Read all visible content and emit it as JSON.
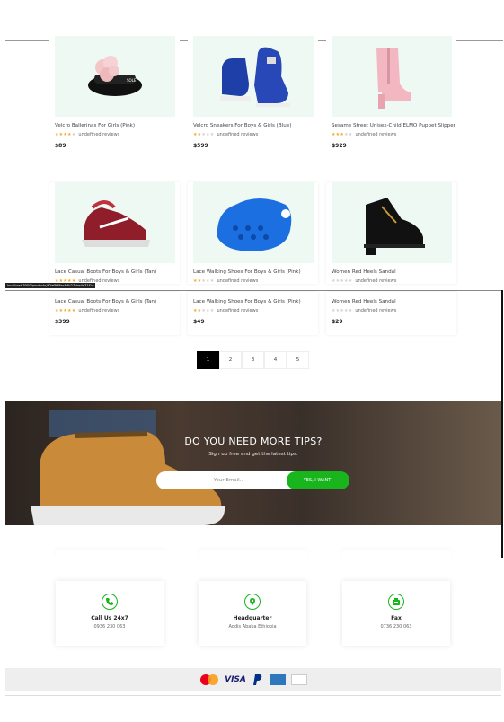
{
  "products_top": [
    {
      "name": "Velcro Ballerinas For Girls (Pink)",
      "rating": 4,
      "reviews": "undefined reviews",
      "price": "$89",
      "image": "pink-slipper"
    },
    {
      "name": "Velcro Sneakers For Boys & Girls (Blue)",
      "rating": 2,
      "reviews": "undefined reviews",
      "price": "$599",
      "image": "blue-sneaker"
    },
    {
      "name": "Sesame Street Unisex-Child ELMO Puppet Slipper",
      "rating": 3,
      "reviews": "undefined reviews",
      "price": "$929",
      "image": "pink-boot"
    }
  ],
  "products_mid": [
    {
      "name": "Lace Casual Boots For Boys & Girls (Tan)",
      "rating": 5,
      "reviews": "undefined reviews",
      "image": "red-sneaker"
    },
    {
      "name": "Lace Walking Shoes For Boys & Girls (Pink)",
      "rating": 2,
      "reviews": "undefined reviews",
      "image": "blue-clog"
    },
    {
      "name": "Women Red Heels Sandal",
      "rating": 0,
      "reviews": "undefined reviews",
      "image": "black-boot"
    }
  ],
  "products_bottom": [
    {
      "name": "Lace Casual Boots For Boys & Girls (Tan)",
      "rating": 5,
      "reviews": "undefined reviews",
      "price": "$399"
    },
    {
      "name": "Lace Walking Shoes For Boys & Girls (Pink)",
      "rating": 2,
      "reviews": "undefined reviews",
      "price": "$49"
    },
    {
      "name": "Women Red Heels Sandal",
      "rating": 0,
      "reviews": "undefined reviews",
      "price": "$29"
    }
  ],
  "tooltip": "localhost:3000/products/62ef998ec84b27cbe4e31f1e",
  "pagination": {
    "pages": [
      "1",
      "2",
      "3",
      "4",
      "5"
    ],
    "active": 1
  },
  "newsletter": {
    "title": "DO YOU NEED MORE TIPS?",
    "subtitle": "Sign up free and get the latest tips.",
    "email_placeholder": "Your Email..",
    "button": "YES, I WANT!"
  },
  "contacts": [
    {
      "label": "Call Us 24x7",
      "value": "0936 230 063",
      "icon": "phone-icon"
    },
    {
      "label": "Headquarter",
      "value": "Addis Ababa Ethiopia",
      "icon": "location-pin-icon"
    },
    {
      "label": "Fax",
      "value": "0736 230 063",
      "icon": "fax-icon"
    }
  ],
  "payments": [
    "mastercard",
    "VISA",
    "PayPal",
    "AMERICAN EXPRESS",
    "DISCOVER"
  ],
  "colors": {
    "accent": "#19b51c",
    "star": "#f0a92b",
    "card_bg": "#eef9f3"
  }
}
